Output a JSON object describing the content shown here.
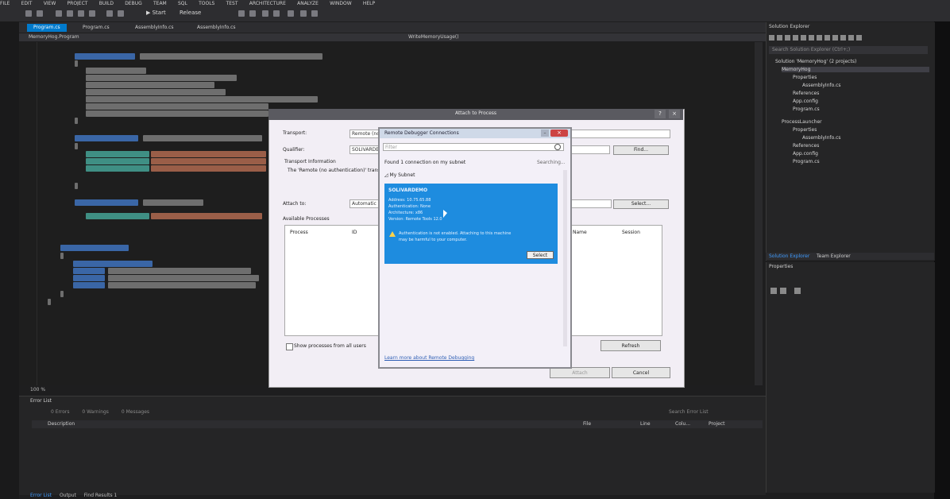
{
  "menu": [
    "FILE",
    "EDIT",
    "VIEW",
    "PROJECT",
    "BUILD",
    "DEBUG",
    "TEAM",
    "SQL",
    "TOOLS",
    "TEST",
    "ARCHITECTURE",
    "ANALYZE",
    "WINDOW",
    "HELP"
  ],
  "toolbar": {
    "start_label": "▶ Start",
    "config_label": "Release"
  },
  "tabs": [
    "Program.cs",
    "Program.cs",
    "AssemblyInfo.cs",
    "AssemblyInfo.cs"
  ],
  "navbar": {
    "left": "MemoryHog.Program",
    "right": "WriteMemoryUsage()"
  },
  "solution_explorer": {
    "title": "Solution Explorer",
    "search_placeholder": "Search Solution Explorer (Ctrl+;)",
    "items": [
      {
        "label": "Solution 'MemoryHog' (2 projects)",
        "depth": 0
      },
      {
        "label": "MemoryHog",
        "depth": 1,
        "selected": true
      },
      {
        "label": "Properties",
        "depth": 2
      },
      {
        "label": "AssemblyInfo.cs",
        "depth": 3
      },
      {
        "label": "References",
        "depth": 2
      },
      {
        "label": "App.config",
        "depth": 2
      },
      {
        "label": "Program.cs",
        "depth": 2
      },
      {
        "label": "ProcessLauncher",
        "depth": 1
      },
      {
        "label": "Properties",
        "depth": 2
      },
      {
        "label": "AssemblyInfo.cs",
        "depth": 3
      },
      {
        "label": "References",
        "depth": 2
      },
      {
        "label": "App.config",
        "depth": 2
      },
      {
        "label": "Program.cs",
        "depth": 2
      }
    ],
    "tab_active": "Solution Explorer",
    "tab_other": "Team Explorer"
  },
  "properties": {
    "title": "Properties"
  },
  "zoom": "100 %",
  "error_list": {
    "title": "Error List",
    "filters": [
      "0 Errors",
      "0 Warnings",
      "0 Messages"
    ],
    "search_placeholder": "Search Error List",
    "columns": [
      "Description",
      "File",
      "Line",
      "Colu...",
      "Project"
    ]
  },
  "bottom_tabs": [
    "Error List",
    "Output",
    "Find Results 1"
  ],
  "attach_dialog": {
    "title": "Attach to Process",
    "transport_label": "Transport:",
    "transport_value": "Remote (no authentication)",
    "qualifier_label": "Qualifier:",
    "qualifier_value": "SOLIVARDEMO",
    "find_label": "Find...",
    "transport_info_label": "Transport Information",
    "transport_info_text": "The 'Remote (no authentication)' transport ... (Default)' transport where possible.",
    "attach_to_label": "Attach to:",
    "attach_to_value": "Automatic",
    "select_label": "Select...",
    "available_label": "Available Processes",
    "col_process": "Process",
    "col_id": "ID",
    "col_name": "Name",
    "col_session": "Session",
    "show_all_label": "Show processes from all users",
    "refresh_label": "Refresh",
    "attach_label": "Attach",
    "cancel_label": "Cancel"
  },
  "rdc_dialog": {
    "title": "Remote Debugger Connections",
    "filter_placeholder": "Filter",
    "found_text": "Found 1 connection on my subnet",
    "searching": "Searching...",
    "group_label": "My Subnet",
    "tile": {
      "name": "SOLIVARDEMO",
      "address": "Address: 10.75.65.88",
      "auth": "Authentication: None",
      "arch": "Architecture: x86",
      "version": "Version: Remote Tools 12.0",
      "warning_line1": "Authentication is not enabled. Attaching to this machine",
      "warning_line2": "may be harmful to your computer.",
      "select_label": "Select"
    },
    "learn_more": "Learn more about Remote Debugging"
  }
}
